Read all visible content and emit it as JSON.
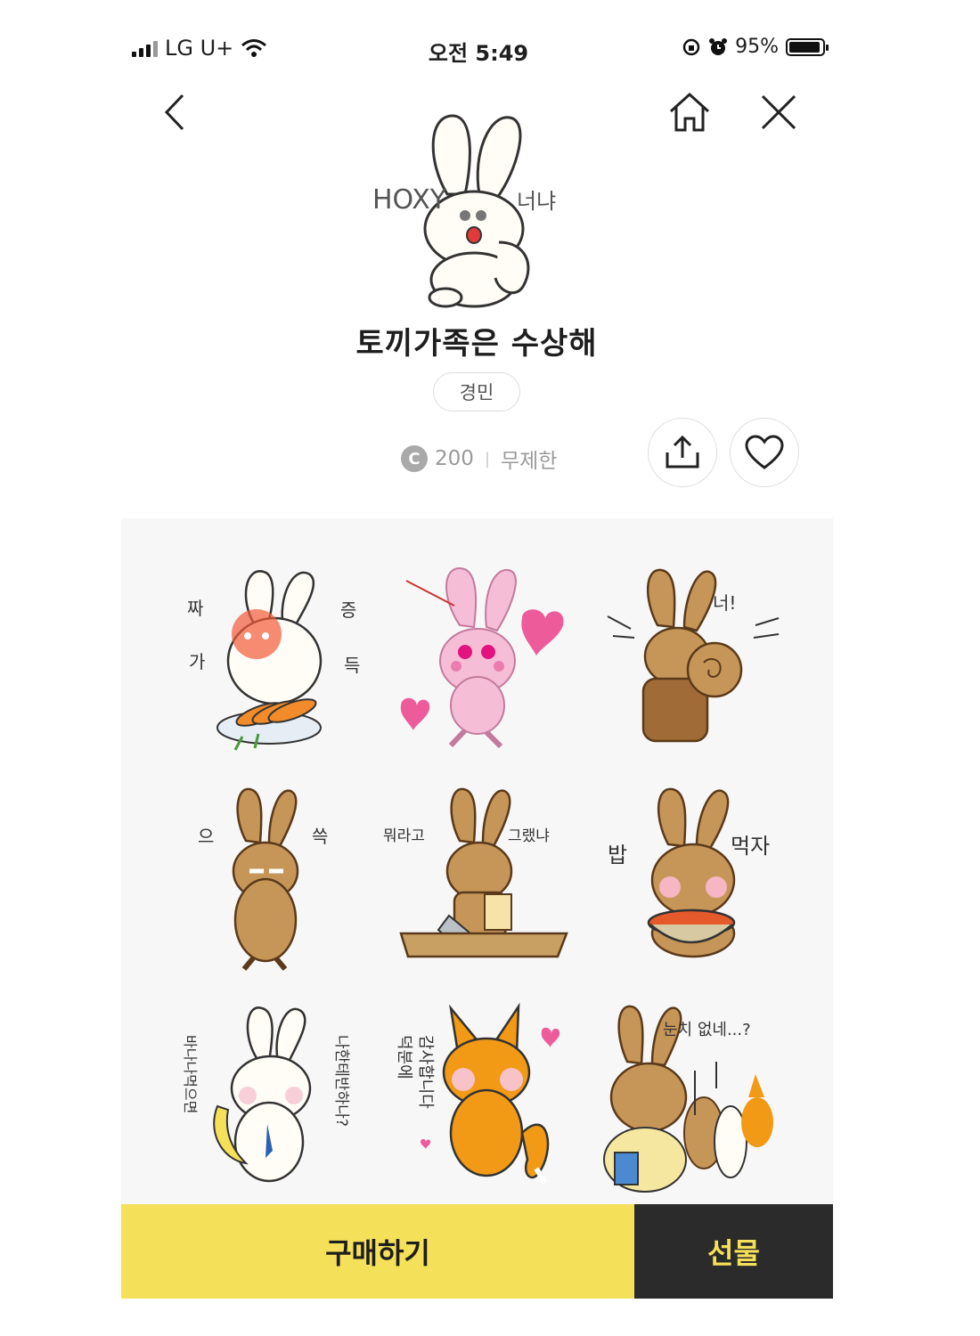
{
  "status_bar": {
    "carrier": "LG U+",
    "time": "오전 5:49",
    "battery": "95%",
    "battery_level": 0.95
  },
  "header": {
    "back_icon": "chevron-left-icon",
    "home_icon": "home-icon",
    "close_icon": "close-icon"
  },
  "product": {
    "hero_text_left": "HOXY",
    "hero_text_right": "너냐",
    "title": "토끼가족은 수상해",
    "author": "경민",
    "price": "200",
    "price_separator": "|",
    "period": "무제한",
    "coin_symbol": "C",
    "share_icon": "share-icon",
    "like_icon": "heart-icon"
  },
  "stickers": [
    {
      "label": "짜증가득",
      "captions": [
        "짜",
        "증",
        "가",
        "득"
      ]
    },
    {
      "label": "heart",
      "captions": []
    },
    {
      "label": "너!",
      "captions": [
        "너!"
      ]
    },
    {
      "label": "으쓱",
      "captions": [
        "으",
        "쓱"
      ]
    },
    {
      "label": "뭐라고 그랬냐",
      "captions": [
        "뭐라고",
        "그랬냐"
      ]
    },
    {
      "label": "밥 먹자",
      "captions": [
        "밥",
        "먹자"
      ]
    },
    {
      "label": "바나나 먹으면 나한테 반하나?",
      "captions": [
        "바나나먹으면",
        "나한테반하나?"
      ]
    },
    {
      "label": "덕분에 감사합니다",
      "captions": [
        "덕분에",
        "감사합니다"
      ]
    },
    {
      "label": "눈치 없네...?",
      "captions": [
        "눈치 없네...?"
      ]
    }
  ],
  "actions": {
    "buy": "구매하기",
    "gift": "선물"
  },
  "colors": {
    "accent": "#f5e05a",
    "dark": "#2b2b2b",
    "white_rabbit": "#fffdf6",
    "brown_rabbit": "#c69659",
    "fox": "#f29a15",
    "pink": "#f6bdd6"
  }
}
